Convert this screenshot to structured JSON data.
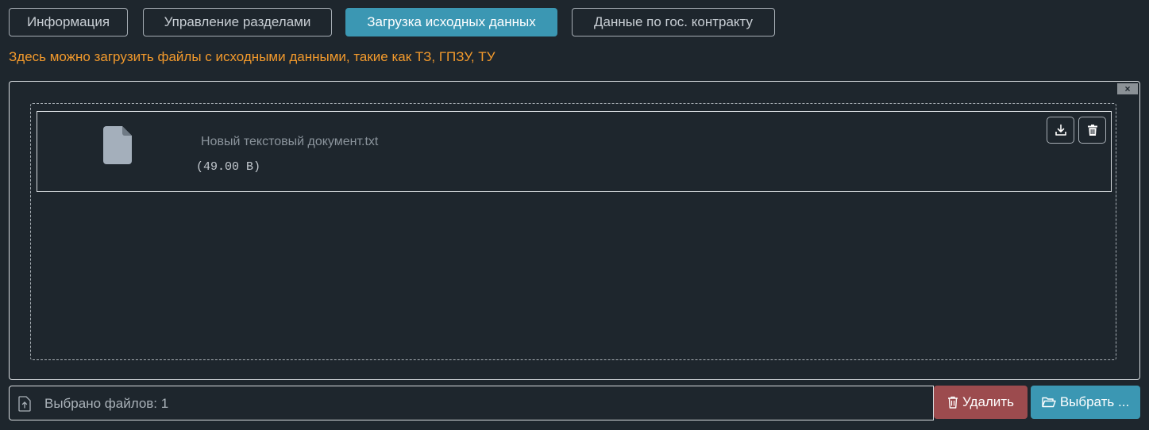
{
  "tabs": [
    {
      "label": "Информация",
      "active": false
    },
    {
      "label": "Управление разделами",
      "active": false
    },
    {
      "label": "Загрузка исходных данных",
      "active": true
    },
    {
      "label": "Данные по гос. контракту",
      "active": false
    }
  ],
  "hint": "Здесь можно загрузить файлы с исходными данными, такие как ТЗ, ГПЗУ, ТУ",
  "panel": {
    "close_label": "×",
    "files": [
      {
        "name": "Новый текстовый документ.txt",
        "size": "(49.00 B)",
        "icon": "file-icon"
      }
    ],
    "file_actions": {
      "download_icon": "download-icon",
      "delete_icon": "trash-icon"
    }
  },
  "footer": {
    "files_selected": "Выбрано файлов: 1",
    "delete_label": "Удалить",
    "select_label": "Выбрать ..."
  },
  "colors": {
    "background": "#1e262d",
    "accent": "#3b97b3",
    "danger": "#9c4b4e",
    "hint": "#f39a2c"
  }
}
